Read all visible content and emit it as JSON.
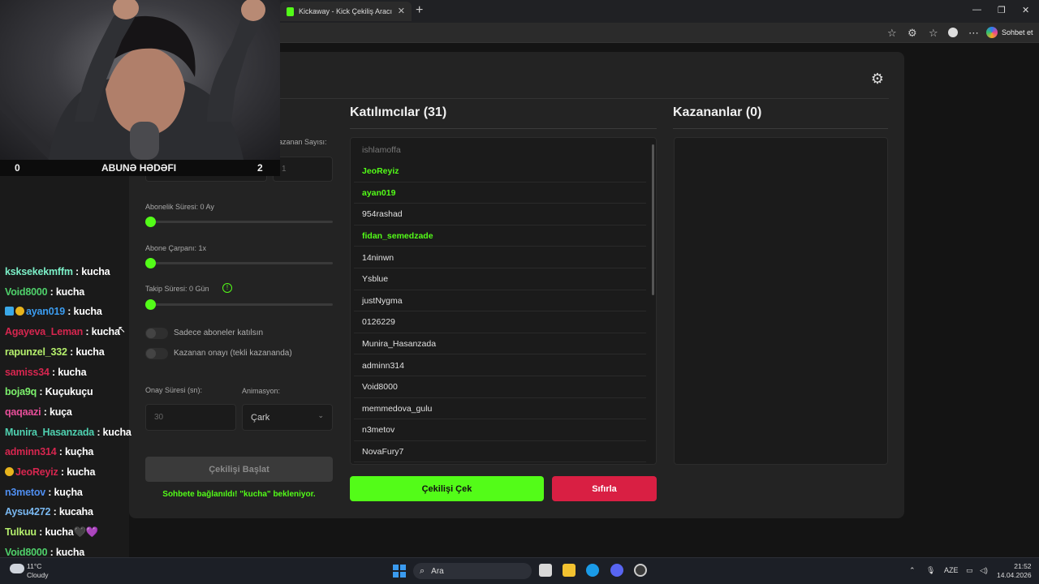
{
  "browser": {
    "tab_title": "Kickaway - Kick Çekiliş Aracı",
    "tab_close": "✕",
    "new_tab": "+",
    "sidebar_button": "Sohbet et",
    "window_controls": [
      "—",
      "❐",
      "✕"
    ]
  },
  "settings": {
    "winner_count_label": "azanan Sayısı:",
    "winner_count_value": "1",
    "sub_duration_label": "Abonelik Süresi: 0 Ay",
    "sub_duration_value": 0,
    "sub_multiplier_label": "Abone Çarpanı: 1x",
    "sub_multiplier_value": 1,
    "follow_duration_label": "Takip Süresi:  0  Gün",
    "follow_duration_value": 0,
    "info_icon": "!",
    "toggle_subs_only": "Sadece aboneler katılsın",
    "toggle_winner_confirm": "Kazanan onayı (tekli kazananda)",
    "confirm_time_label": "Onay Süresi (sn):",
    "confirm_time_value": "30",
    "animation_label": "Animasyon:",
    "animation_value": "Çark",
    "start_button": "Çekilişi Başlat",
    "status_text": "Sohbete bağlanıldı! \"kucha\" bekleniyor."
  },
  "participants": {
    "title": "Katılımcılar (31)",
    "items": [
      {
        "name": "ishlamoffa",
        "style": "first"
      },
      {
        "name": "JeoReyiz",
        "style": "green"
      },
      {
        "name": "ayan019",
        "style": "green"
      },
      {
        "name": "954rashad",
        "style": "normal"
      },
      {
        "name": "fidan_semedzade",
        "style": "green"
      },
      {
        "name": "14ninwn",
        "style": "normal"
      },
      {
        "name": "Ysblue",
        "style": "normal"
      },
      {
        "name": "justNygma",
        "style": "normal"
      },
      {
        "name": "0126229",
        "style": "normal"
      },
      {
        "name": "Munira_Hasanzada",
        "style": "normal"
      },
      {
        "name": "adminn314",
        "style": "normal"
      },
      {
        "name": "Void8000",
        "style": "normal"
      },
      {
        "name": "memmedova_gulu",
        "style": "normal"
      },
      {
        "name": "n3metov",
        "style": "normal"
      },
      {
        "name": "NovaFury7",
        "style": "normal"
      }
    ]
  },
  "winners": {
    "title": "Kazananlar (0)"
  },
  "actions": {
    "draw_button": "Çekilişi Çek",
    "reset_button": "Sıfırla"
  },
  "stream": {
    "goal_left": "0",
    "goal_title": "ABUNƏ HƏDƏFI",
    "goal_right": "2",
    "chat": [
      {
        "user": "ksksekekmffm",
        "color": "#7cf0c8",
        "msg": " : kucha",
        "badges": []
      },
      {
        "user": "Void8000",
        "color": "#4fd16b",
        "msg": " : kucha",
        "badges": []
      },
      {
        "user": "ayan019",
        "color": "#3b9cf0",
        "msg": " : kucha",
        "badges": [
          "blue",
          "gold"
        ]
      },
      {
        "user": "Agayeva_Leman",
        "color": "#d6264f",
        "msg": " : kucha",
        "badges": []
      },
      {
        "user": "rapunzel_332",
        "color": "#b4ee6c",
        "msg": " : kucha",
        "badges": []
      },
      {
        "user": "samiss34",
        "color": "#d6264f",
        "msg": " : kucha",
        "badges": []
      },
      {
        "user": "boja9q",
        "color": "#7cf06c",
        "msg": " : Kuçukuçu",
        "badges": []
      },
      {
        "user": "qaqaazi",
        "color": "#e84f9a",
        "msg": " : kuça",
        "badges": []
      },
      {
        "user": "Munira_Hasanzada",
        "color": "#4fd1b0",
        "msg": " : kucha",
        "badges": []
      },
      {
        "user": "adminn314",
        "color": "#d6264f",
        "msg": " : kuçha",
        "badges": []
      },
      {
        "user": "JeoReyiz",
        "color": "#d6264f",
        "msg": " : kucha",
        "badges": [
          "gold"
        ]
      },
      {
        "user": "n3metov",
        "color": "#4f8ef0",
        "msg": " : kuçha",
        "badges": []
      },
      {
        "user": "Aysu4272",
        "color": "#7ab8f0",
        "msg": " : kucaha",
        "badges": []
      },
      {
        "user": "Tulkuu",
        "color": "#b4ee6c",
        "msg": " : kucha🖤💜",
        "badges": []
      },
      {
        "user": "Void8000",
        "color": "#4fd16b",
        "msg": " : kucha",
        "badges": []
      }
    ]
  },
  "taskbar": {
    "weather_temp": "11°C",
    "weather_cond": "Cloudy",
    "search_placeholder": "Ara",
    "lang": "AZE",
    "time": "21:52",
    "date": "14.04.2026"
  },
  "colors": {
    "kick_green": "#53fc18",
    "reset_red": "#d91f43"
  }
}
